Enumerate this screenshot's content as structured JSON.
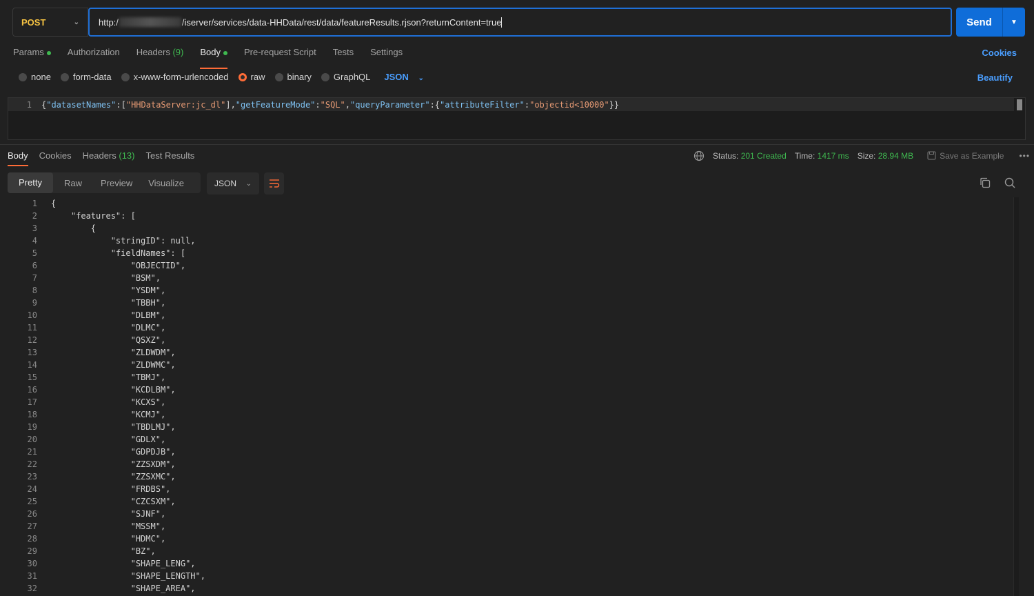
{
  "request": {
    "method": "POST",
    "url_prefix": "http:/",
    "url_suffix": "/iserver/services/data-HHData/rest/data/featureResults.rjson?returnContent=true",
    "send_label": "Send"
  },
  "request_tabs": {
    "params": "Params",
    "authorization": "Authorization",
    "headers": "Headers",
    "headers_count": "(9)",
    "body": "Body",
    "prerequest": "Pre-request Script",
    "tests": "Tests",
    "settings": "Settings",
    "cookies": "Cookies"
  },
  "body_types": {
    "none": "none",
    "form_data": "form-data",
    "urlencoded": "x-www-form-urlencoded",
    "raw": "raw",
    "binary": "binary",
    "graphql": "GraphQL",
    "language": "JSON",
    "beautify": "Beautify"
  },
  "request_body": {
    "line_number": "1",
    "parts": [
      {
        "t": "p",
        "v": "{"
      },
      {
        "t": "k",
        "v": "\"datasetNames\""
      },
      {
        "t": "p",
        "v": ":["
      },
      {
        "t": "s",
        "v": "\"HHDataServer:jc_dl\""
      },
      {
        "t": "p",
        "v": "],"
      },
      {
        "t": "k",
        "v": "\"getFeatureMode\""
      },
      {
        "t": "p",
        "v": ":"
      },
      {
        "t": "s",
        "v": "\"SQL\""
      },
      {
        "t": "p",
        "v": ","
      },
      {
        "t": "k",
        "v": "\"queryParameter\""
      },
      {
        "t": "p",
        "v": ":{"
      },
      {
        "t": "k",
        "v": "\"attributeFilter\""
      },
      {
        "t": "p",
        "v": ":"
      },
      {
        "t": "s",
        "v": "\"objectid<10000\""
      },
      {
        "t": "p",
        "v": "}}"
      }
    ]
  },
  "response_tabs": {
    "body": "Body",
    "cookies": "Cookies",
    "headers": "Headers",
    "headers_count": "(13)",
    "test_results": "Test Results"
  },
  "response_status": {
    "status_label": "Status:",
    "status_value": "201 Created",
    "time_label": "Time:",
    "time_value": "1417 ms",
    "size_label": "Size:",
    "size_value": "28.94 MB",
    "save_example": "Save as Example"
  },
  "view_tabs": {
    "pretty": "Pretty",
    "raw": "Raw",
    "preview": "Preview",
    "visualize": "Visualize",
    "format": "JSON"
  },
  "response_lines": [
    {
      "n": "1",
      "text": "{"
    },
    {
      "n": "2",
      "text": "    \"features\": ["
    },
    {
      "n": "3",
      "text": "        {"
    },
    {
      "n": "4",
      "text": "            \"stringID\": null,"
    },
    {
      "n": "5",
      "text": "            \"fieldNames\": ["
    },
    {
      "n": "6",
      "text": "                \"OBJECTID\","
    },
    {
      "n": "7",
      "text": "                \"BSM\","
    },
    {
      "n": "8",
      "text": "                \"YSDM\","
    },
    {
      "n": "9",
      "text": "                \"TBBH\","
    },
    {
      "n": "10",
      "text": "                \"DLBM\","
    },
    {
      "n": "11",
      "text": "                \"DLMC\","
    },
    {
      "n": "12",
      "text": "                \"QSXZ\","
    },
    {
      "n": "13",
      "text": "                \"ZLDWDM\","
    },
    {
      "n": "14",
      "text": "                \"ZLDWMC\","
    },
    {
      "n": "15",
      "text": "                \"TBMJ\","
    },
    {
      "n": "16",
      "text": "                \"KCDLBM\","
    },
    {
      "n": "17",
      "text": "                \"KCXS\","
    },
    {
      "n": "18",
      "text": "                \"KCMJ\","
    },
    {
      "n": "19",
      "text": "                \"TBDLMJ\","
    },
    {
      "n": "20",
      "text": "                \"GDLX\","
    },
    {
      "n": "21",
      "text": "                \"GDPDJB\","
    },
    {
      "n": "22",
      "text": "                \"ZZSXDM\","
    },
    {
      "n": "23",
      "text": "                \"ZZSXMC\","
    },
    {
      "n": "24",
      "text": "                \"FRDBS\","
    },
    {
      "n": "25",
      "text": "                \"CZCSXM\","
    },
    {
      "n": "26",
      "text": "                \"SJNF\","
    },
    {
      "n": "27",
      "text": "                \"MSSM\","
    },
    {
      "n": "28",
      "text": "                \"HDMC\","
    },
    {
      "n": "29",
      "text": "                \"BZ\","
    },
    {
      "n": "30",
      "text": "                \"SHAPE_LENG\","
    },
    {
      "n": "31",
      "text": "                \"SHAPE_LENGTH\","
    },
    {
      "n": "32",
      "text": "                \"SHAPE_AREA\","
    }
  ],
  "colors": {
    "accent": "#ff6c37",
    "send": "#0f6dd9",
    "method": "#f5c242",
    "link": "#4a9eff",
    "success": "#3fb950"
  },
  "icons": [
    "chevron-down-icon",
    "globe-icon",
    "save-icon",
    "more-icon",
    "wrap-lines-icon",
    "copy-icon",
    "search-icon"
  ]
}
